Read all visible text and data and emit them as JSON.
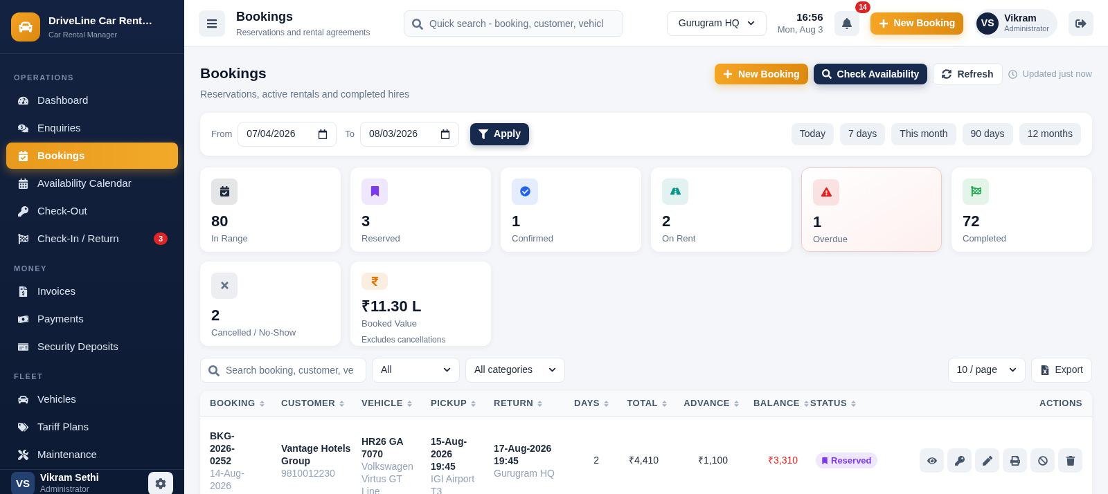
{
  "brand": {
    "name": "DriveLine Car Rent…",
    "subtitle": "Car Rental Manager"
  },
  "sidebar": {
    "sections": [
      {
        "title": "OPERATIONS",
        "items": [
          {
            "label": "Dashboard",
            "selected": false
          },
          {
            "label": "Enquiries",
            "selected": false
          },
          {
            "label": "Bookings",
            "selected": true
          },
          {
            "label": "Availability Calendar",
            "selected": false
          },
          {
            "label": "Check-Out",
            "selected": false
          },
          {
            "label": "Check-In / Return",
            "selected": false,
            "badge": "3"
          }
        ]
      },
      {
        "title": "MONEY",
        "items": [
          {
            "label": "Invoices",
            "selected": false
          },
          {
            "label": "Payments",
            "selected": false
          },
          {
            "label": "Security Deposits",
            "selected": false
          }
        ]
      },
      {
        "title": "FLEET",
        "items": [
          {
            "label": "Vehicles",
            "selected": false
          },
          {
            "label": "Tariff Plans",
            "selected": false
          },
          {
            "label": "Maintenance",
            "selected": false
          }
        ]
      }
    ],
    "user": {
      "initials": "VS",
      "name": "Vikram Sethi",
      "role": "Administrator"
    }
  },
  "topbar": {
    "title": "Bookings",
    "subtitle": "Reservations and rental agreements",
    "search": {
      "placeholder": "Quick search - booking, customer, vehicl"
    },
    "branch": "Gurugram HQ",
    "time": "16:56",
    "date": "Mon, Aug 3",
    "notifications": "14",
    "new_booking": "New Booking",
    "user": {
      "initials": "VS",
      "name": "Vikram",
      "role": "Administrator"
    }
  },
  "page": {
    "title": "Bookings",
    "subtitle": "Reservations, active rentals and completed hires",
    "actions": {
      "new_booking": "New Booking",
      "check_availability": "Check Availability",
      "refresh": "Refresh",
      "updated": "Updated just now"
    }
  },
  "filters": {
    "from_label": "From",
    "from": "07/04/2026",
    "to_label": "To",
    "to": "08/03/2026",
    "apply": "Apply",
    "presets": [
      "Today",
      "7 days",
      "This month",
      "90 days",
      "12 months"
    ]
  },
  "stats": [
    {
      "color": "#1e293b",
      "value": "80",
      "label": "In Range",
      "alert": false
    },
    {
      "color": "#7c3aed",
      "value": "3",
      "label": "Reserved",
      "alert": false
    },
    {
      "color": "#2563eb",
      "value": "1",
      "label": "Confirmed",
      "alert": false
    },
    {
      "color": "#0d9488",
      "value": "2",
      "label": "On Rent",
      "alert": false
    },
    {
      "color": "#dc2626",
      "value": "1",
      "label": "Overdue",
      "alert": true
    },
    {
      "color": "#16a34a",
      "value": "72",
      "label": "Completed",
      "alert": false
    },
    {
      "color": "#64748b",
      "value": "2",
      "label": "Cancelled / No-Show",
      "alert": false
    },
    {
      "color": "#d97706",
      "value": "₹11.30 L",
      "label": "Booked Value",
      "note": "Excludes cancellations",
      "alert": false
    }
  ],
  "toolbar": {
    "search": {
      "placeholder": "Search booking, customer, ve"
    },
    "status_filter": "All",
    "category_filter": "All categories",
    "page_size": "10 / page",
    "export": "Export"
  },
  "table": {
    "columns": [
      {
        "label": "BOOKING",
        "sortable": true
      },
      {
        "label": "CUSTOMER",
        "sortable": true
      },
      {
        "label": "VEHICLE",
        "sortable": true
      },
      {
        "label": "PICKUP",
        "sortable": true
      },
      {
        "label": "RETURN",
        "sortable": true
      },
      {
        "label": "DAYS",
        "sortable": true
      },
      {
        "label": "TOTAL",
        "sortable": true
      },
      {
        "label": "ADVANCE",
        "sortable": true
      },
      {
        "label": "BALANCE",
        "sortable": true
      },
      {
        "label": "STATUS",
        "sortable": true
      },
      {
        "label": "ACTIONS",
        "sortable": false
      }
    ],
    "rows": [
      {
        "booking": "BKG-2026-0252",
        "booking_date": "14-Aug-2026",
        "customer": "Vantage Hotels Group",
        "phone": "9810012230",
        "vehicle": "HR26 GA 7070",
        "model": "Volkswagen Virtus GT Line",
        "pickup": "15-Aug-2026 19:45",
        "pickup_place": "IGI Airport T3",
        "return": "17-Aug-2026 19:45",
        "return_place": "Gurugram HQ",
        "days": "2",
        "total": "₹4,410",
        "advance": "₹1,100",
        "balance": "₹3,310",
        "balance_due": true,
        "status": "Reserved"
      }
    ]
  }
}
